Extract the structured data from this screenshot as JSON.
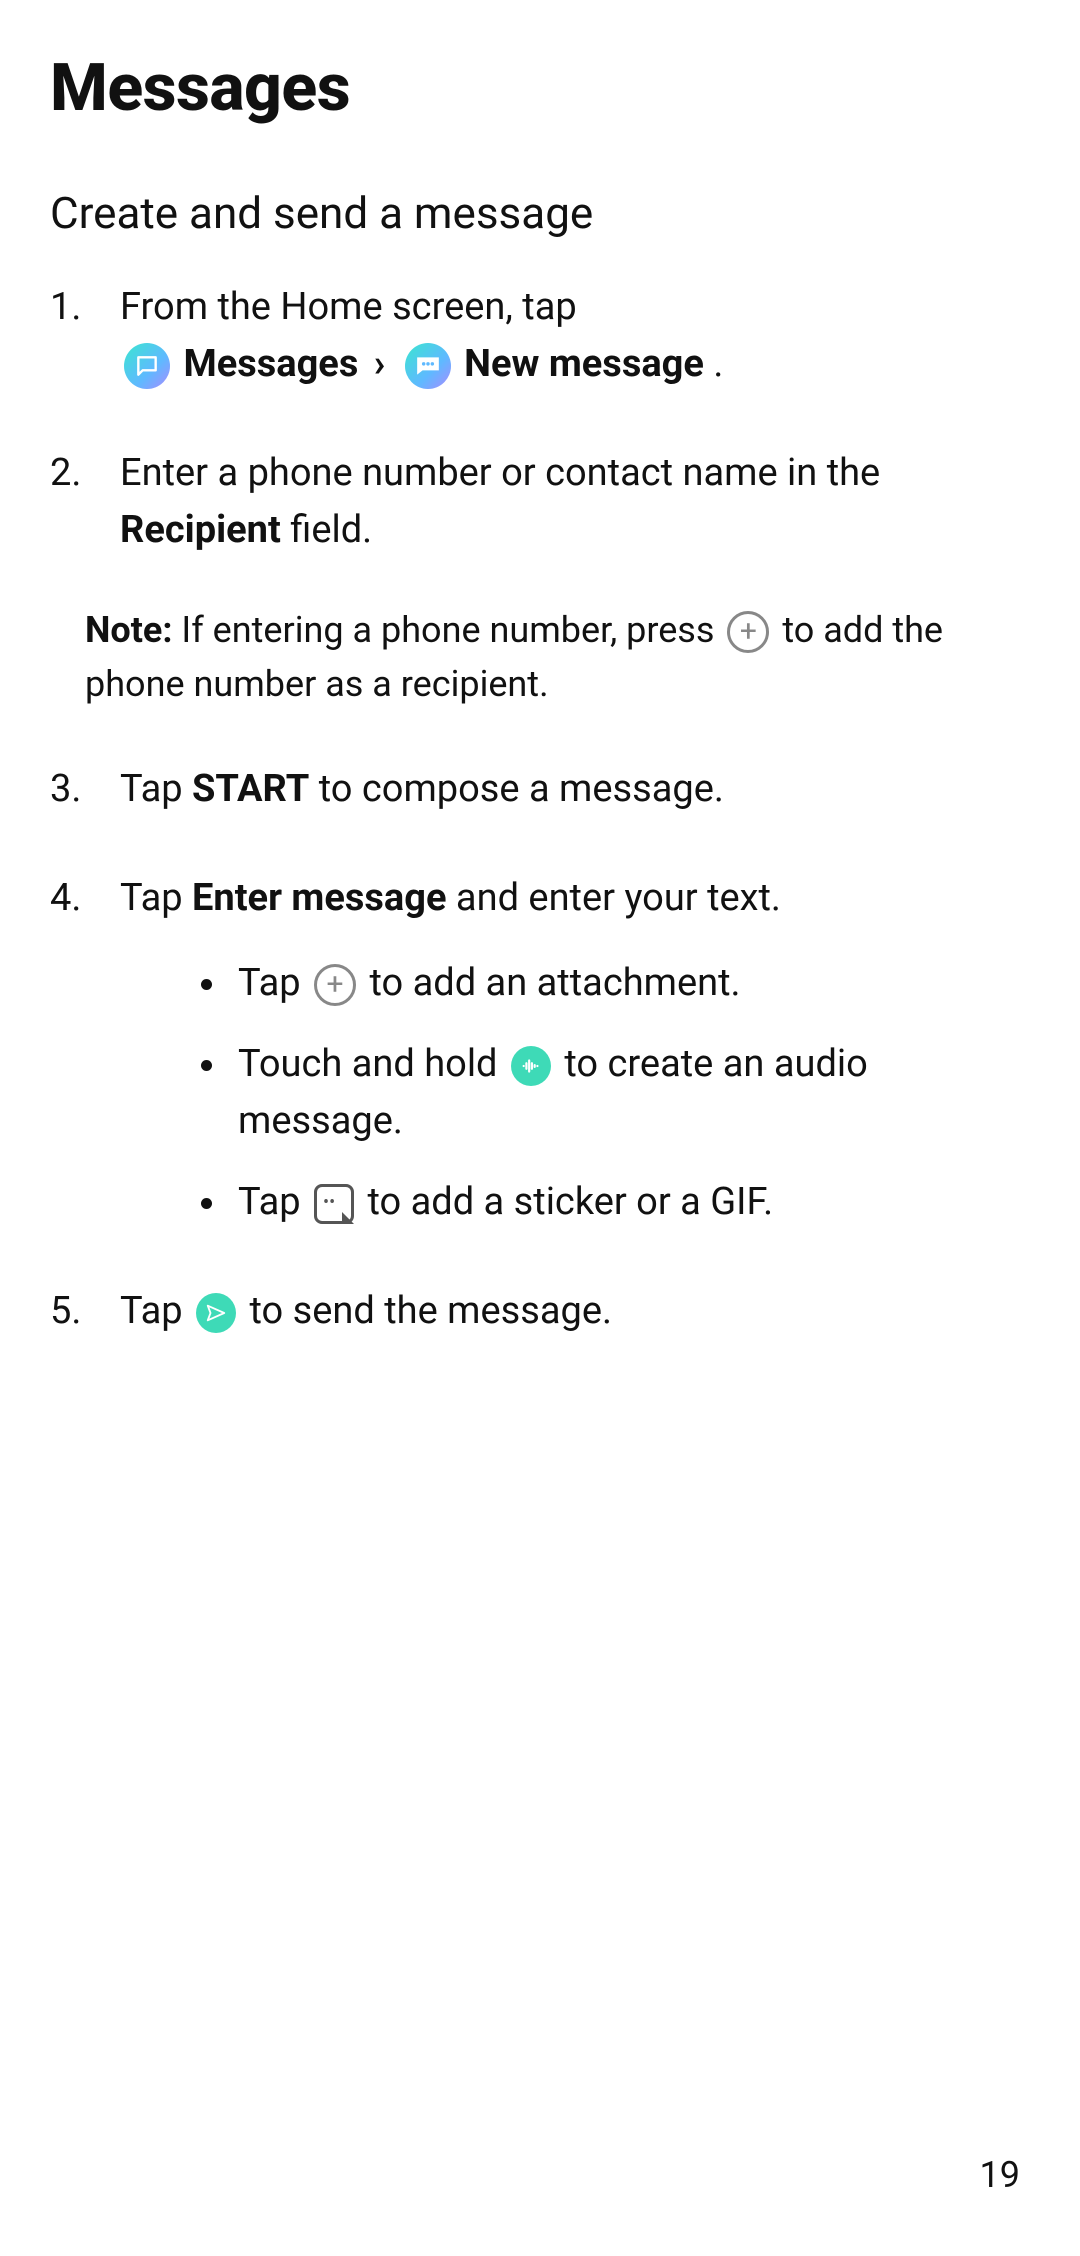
{
  "title": "Messages",
  "subtitle": "Create and send a message",
  "step1": {
    "lead": "From the Home screen, tap",
    "messages_label": "Messages",
    "chevron": "›",
    "new_message_label": "New message",
    "period": "."
  },
  "step2": {
    "pre": "Enter a phone number or contact name in the ",
    "recipient_bold": "Recipient",
    "post": " field."
  },
  "note": {
    "label": "Note:",
    "pre": " If entering a phone number, press ",
    "post": " to add the phone number as a recipient."
  },
  "step3": {
    "pre": "Tap ",
    "start_bold": "START",
    "post": " to compose a message."
  },
  "step4": {
    "pre": "Tap ",
    "enter_bold": "Enter message",
    "post": " and enter your text."
  },
  "sub": {
    "a_pre": "Tap ",
    "a_post": " to add an attachment.",
    "b_pre": "Touch and hold ",
    "b_post": " to create an audio message.",
    "c_pre": "Tap ",
    "c_post": " to add a sticker or a GIF."
  },
  "step5": {
    "pre": "Tap ",
    "post": " to send the message."
  },
  "page_number": "19"
}
